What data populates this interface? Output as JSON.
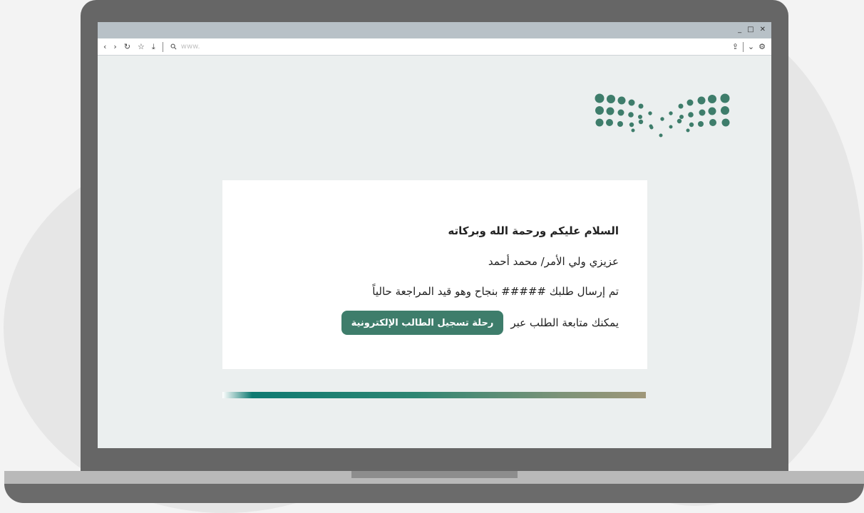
{
  "browser": {
    "window_controls": [
      "_",
      "□",
      "✕"
    ],
    "nav_icons": [
      "‹",
      "›",
      "↻",
      "☆",
      "⤓"
    ],
    "url_placeholder": "www.",
    "right_icons": [
      "⇪",
      "⌄",
      "⚙"
    ]
  },
  "logo": {
    "accent_color": "#3e7d6b"
  },
  "message": {
    "greeting": "السلام عليكم ورحمة الله وبركاته",
    "salutation": "عزيزي ولي الأمر/ محمد أحمد",
    "status": "تم إرسال طلبك ##### بنجاح وهو قيد المراجعة حالياً",
    "follow_text": "يمكنك متابعة الطلب عبر",
    "button_label": "رحلة تسجيل الطالب الإلكترونية"
  },
  "colors": {
    "accent": "#3e7d6b",
    "gradient_start": "#0f7a72",
    "gradient_end": "#9f9779"
  }
}
